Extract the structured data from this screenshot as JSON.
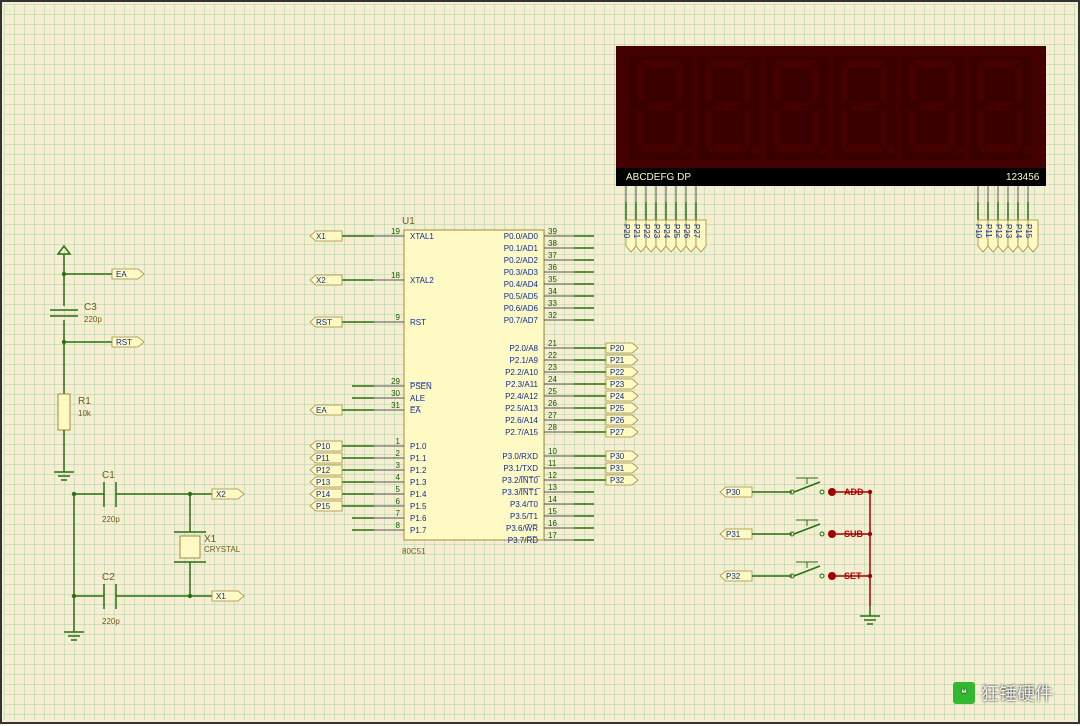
{
  "ic": {
    "ref": "U1",
    "part": "80C51",
    "pins_left": [
      {
        "num": "19",
        "name": "XTAL1",
        "net": "X1"
      },
      {
        "num": "18",
        "name": "XTAL2",
        "net": "X2"
      },
      {
        "num": "9",
        "name": "RST",
        "net": "RST"
      },
      {
        "num": "29",
        "name": "P̅S̅E̅N̅",
        "net": ""
      },
      {
        "num": "30",
        "name": "ALE",
        "net": ""
      },
      {
        "num": "31",
        "name": "E̅A̅",
        "net": "EA"
      },
      {
        "num": "1",
        "name": "P1.0",
        "net": "P10"
      },
      {
        "num": "2",
        "name": "P1.1",
        "net": "P11"
      },
      {
        "num": "3",
        "name": "P1.2",
        "net": "P12"
      },
      {
        "num": "4",
        "name": "P1.3",
        "net": "P13"
      },
      {
        "num": "5",
        "name": "P1.4",
        "net": "P14"
      },
      {
        "num": "6",
        "name": "P1.5",
        "net": "P15"
      },
      {
        "num": "7",
        "name": "P1.6",
        "net": ""
      },
      {
        "num": "8",
        "name": "P1.7",
        "net": ""
      }
    ],
    "pins_right": [
      {
        "num": "39",
        "name": "P0.0/AD0"
      },
      {
        "num": "38",
        "name": "P0.1/AD1"
      },
      {
        "num": "37",
        "name": "P0.2/AD2"
      },
      {
        "num": "36",
        "name": "P0.3/AD3"
      },
      {
        "num": "35",
        "name": "P0.4/AD4"
      },
      {
        "num": "34",
        "name": "P0.5/AD5"
      },
      {
        "num": "33",
        "name": "P0.6/AD6"
      },
      {
        "num": "32",
        "name": "P0.7/AD7"
      },
      {
        "num": "21",
        "name": "P2.0/A8",
        "net": "P20"
      },
      {
        "num": "22",
        "name": "P2.1/A9",
        "net": "P21"
      },
      {
        "num": "23",
        "name": "P2.2/A10",
        "net": "P22"
      },
      {
        "num": "24",
        "name": "P2.3/A11",
        "net": "P23"
      },
      {
        "num": "25",
        "name": "P2.4/A12",
        "net": "P24"
      },
      {
        "num": "26",
        "name": "P2.5/A13",
        "net": "P25"
      },
      {
        "num": "27",
        "name": "P2.6/A14",
        "net": "P26"
      },
      {
        "num": "28",
        "name": "P2.7/A15",
        "net": "P27"
      },
      {
        "num": "10",
        "name": "P3.0/RXD",
        "net": "P30"
      },
      {
        "num": "11",
        "name": "P3.1/TXD",
        "net": "P31"
      },
      {
        "num": "12",
        "name": "P3.2/I̅N̅T̅0̅",
        "net": "P32"
      },
      {
        "num": "13",
        "name": "P3.3/I̅N̅T̅1̅"
      },
      {
        "num": "14",
        "name": "P3.4/T0"
      },
      {
        "num": "15",
        "name": "P3.5/T1"
      },
      {
        "num": "16",
        "name": "P3.6/W̅R̅"
      },
      {
        "num": "17",
        "name": "P3.7/R̅D̅"
      }
    ]
  },
  "osc": {
    "c1": {
      "ref": "C1",
      "val": "220p"
    },
    "c2": {
      "ref": "C2",
      "val": "220p"
    },
    "crystal": {
      "ref": "X1",
      "val": "CRYSTAL"
    },
    "x1_net": "X1",
    "x2_net": "X2"
  },
  "reset": {
    "c3": {
      "ref": "C3",
      "val": "220p"
    },
    "r1": {
      "ref": "R1",
      "val": "10k"
    },
    "ea_net": "EA",
    "rst_net": "RST"
  },
  "display": {
    "seg_label": "ABCDEFG DP",
    "digit_label": "123456",
    "seg_nets": [
      "P20",
      "P21",
      "P22",
      "P23",
      "P24",
      "P25",
      "P26",
      "P27"
    ],
    "digit_nets": [
      "P10",
      "P11",
      "P12",
      "P13",
      "P14",
      "P15"
    ]
  },
  "buttons": [
    {
      "net": "P30",
      "name": "ADD"
    },
    {
      "net": "P31",
      "name": "SUB"
    },
    {
      "net": "P32",
      "name": "SET"
    }
  ],
  "watermark": "狂锤硬件"
}
